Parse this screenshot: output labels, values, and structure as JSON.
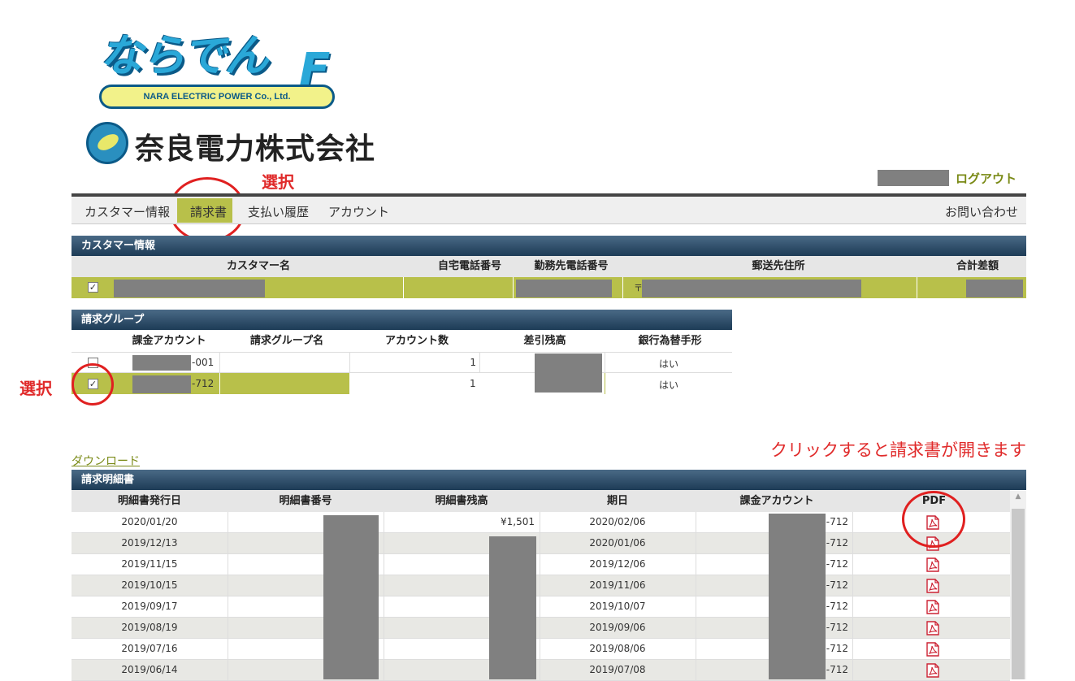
{
  "logo": {
    "brand_jp": "ならでん",
    "brand_f": "F",
    "brand_en": "NARA ELECTRIC POWER Co., Ltd.",
    "company_jp": "奈良電力株式会社"
  },
  "annotations": {
    "select_top": "選択",
    "select_left": "選択",
    "click_note": "クリックすると請求書が開きます",
    "color": "#e02a2a"
  },
  "header": {
    "logout": "ログアウト"
  },
  "nav": {
    "items": [
      "カスタマー情報",
      "請求書",
      "支払い履歴",
      "アカウント"
    ],
    "active": "請求書",
    "right": "お問い合わせ"
  },
  "customer": {
    "title": "カスタマー情報",
    "columns": [
      "カスタマー名",
      "自宅電話番号",
      "勤務先電話番号",
      "郵送先住所",
      "合計差額"
    ],
    "row": {
      "checked": true,
      "address_prefix": "〒"
    }
  },
  "billing_group": {
    "title": "請求グループ",
    "columns": [
      "課金アカウント",
      "請求グループ名",
      "アカウント数",
      "差引残高",
      "銀行為替手形"
    ],
    "rows": [
      {
        "checked": false,
        "account_suffix": "-001",
        "group_name": "",
        "count": "1",
        "bank": "はい"
      },
      {
        "checked": true,
        "account_suffix": "-712",
        "group_name": "",
        "count": "1",
        "bank": "はい"
      }
    ]
  },
  "download": "ダウンロード",
  "statements": {
    "title": "請求明細書",
    "columns": [
      "明細書発行日",
      "明細書番号",
      "明細書残高",
      "期日",
      "課金アカウント",
      "PDF"
    ],
    "rows": [
      {
        "issue": "2020/01/20",
        "balance": "¥1,501",
        "due": "2020/02/06",
        "account": "-712"
      },
      {
        "issue": "2019/12/13",
        "balance": "",
        "due": "2020/01/06",
        "account": "-712"
      },
      {
        "issue": "2019/11/15",
        "balance": "",
        "due": "2019/12/06",
        "account": "-712"
      },
      {
        "issue": "2019/10/15",
        "balance": "",
        "due": "2019/11/06",
        "account": "-712"
      },
      {
        "issue": "2019/09/17",
        "balance": "",
        "due": "2019/10/07",
        "account": "-712"
      },
      {
        "issue": "2019/08/19",
        "balance": "",
        "due": "2019/09/06",
        "account": "-712"
      },
      {
        "issue": "2019/07/16",
        "balance": "",
        "due": "2019/08/06",
        "account": "-712"
      },
      {
        "issue": "2019/06/14",
        "balance": "",
        "due": "2019/07/08",
        "account": "-712"
      }
    ]
  },
  "colors": {
    "accent_green": "#b8c04a",
    "panel_navy": "#1d3b56",
    "logout_text": "#7a8a16"
  }
}
